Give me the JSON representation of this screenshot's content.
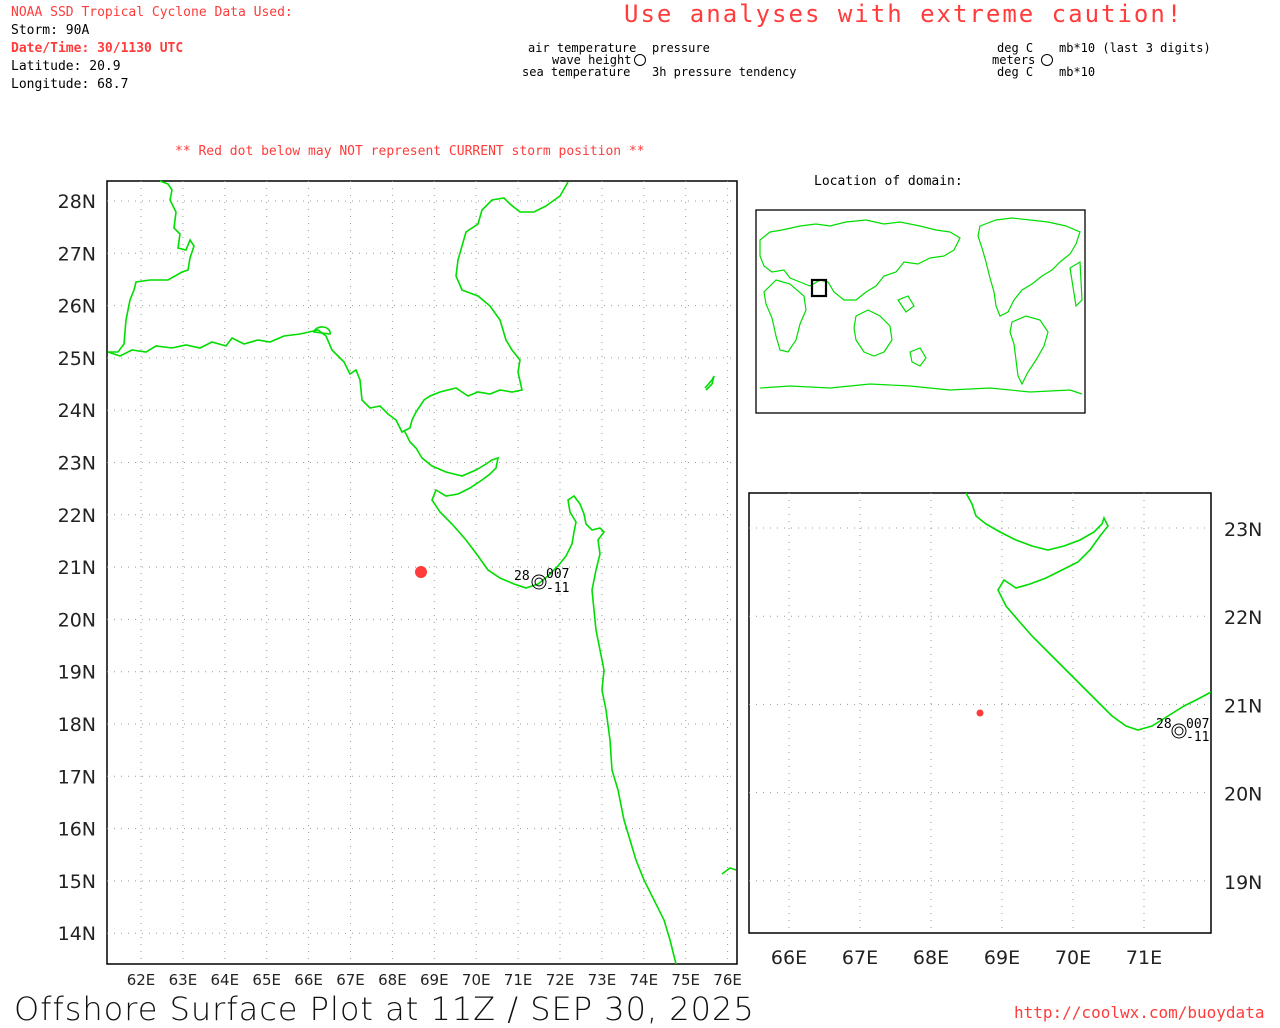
{
  "header": {
    "source_title": "NOAA SSD Tropical Cyclone Data Used:",
    "storm": "Storm: 90A",
    "datetime": "Date/Time: 30/1130 UTC",
    "latitude": "Latitude: 20.9",
    "longitude": "Longitude: 68.7",
    "warning": "Use analyses with extreme caution!",
    "red_dot_note": "** Red dot below may NOT represent CURRENT storm position **",
    "location_of_domain": "Location of domain:"
  },
  "legend": {
    "left": {
      "air_temperature": "air temperature",
      "wave_height": "wave height",
      "sea_temperature": "sea temperature",
      "pressure": "pressure",
      "pressure_tendency": "3h pressure tendency"
    },
    "right": {
      "deg_c_top": "deg C",
      "meters": "meters",
      "deg_c_bottom": "deg C",
      "mb_last3": "mb*10 (last 3 digits)",
      "mb": "mb*10"
    }
  },
  "main_map": {
    "lat_labels": [
      "28N",
      "27N",
      "26N",
      "25N",
      "24N",
      "23N",
      "22N",
      "21N",
      "20N",
      "19N",
      "18N",
      "17N",
      "16N",
      "15N",
      "14N"
    ],
    "lon_labels": [
      "62E",
      "63E",
      "64E",
      "65E",
      "66E",
      "67E",
      "68E",
      "69E",
      "70E",
      "71E",
      "72E",
      "73E",
      "74E",
      "75E",
      "76E"
    ],
    "station": {
      "air_temp": "28",
      "pressure": "007",
      "tendency": "-11"
    },
    "storm_position": {
      "lat": 20.9,
      "lon": 68.7
    }
  },
  "inset_map": {
    "lat_labels": [
      "23N",
      "22N",
      "21N",
      "20N",
      "19N"
    ],
    "lon_labels": [
      "66E",
      "67E",
      "68E",
      "69E",
      "70E",
      "71E"
    ],
    "station": {
      "air_temp": "28",
      "pressure": "007",
      "tendency": "-11"
    }
  },
  "footer": {
    "title": "Offshore Surface Plot at 11Z / SEP 30, 2025",
    "url": "http://coolwx.com/buoydata"
  },
  "colors": {
    "coast": "#00dd00",
    "accent": "#ff3b3b",
    "grid": "#999999"
  }
}
